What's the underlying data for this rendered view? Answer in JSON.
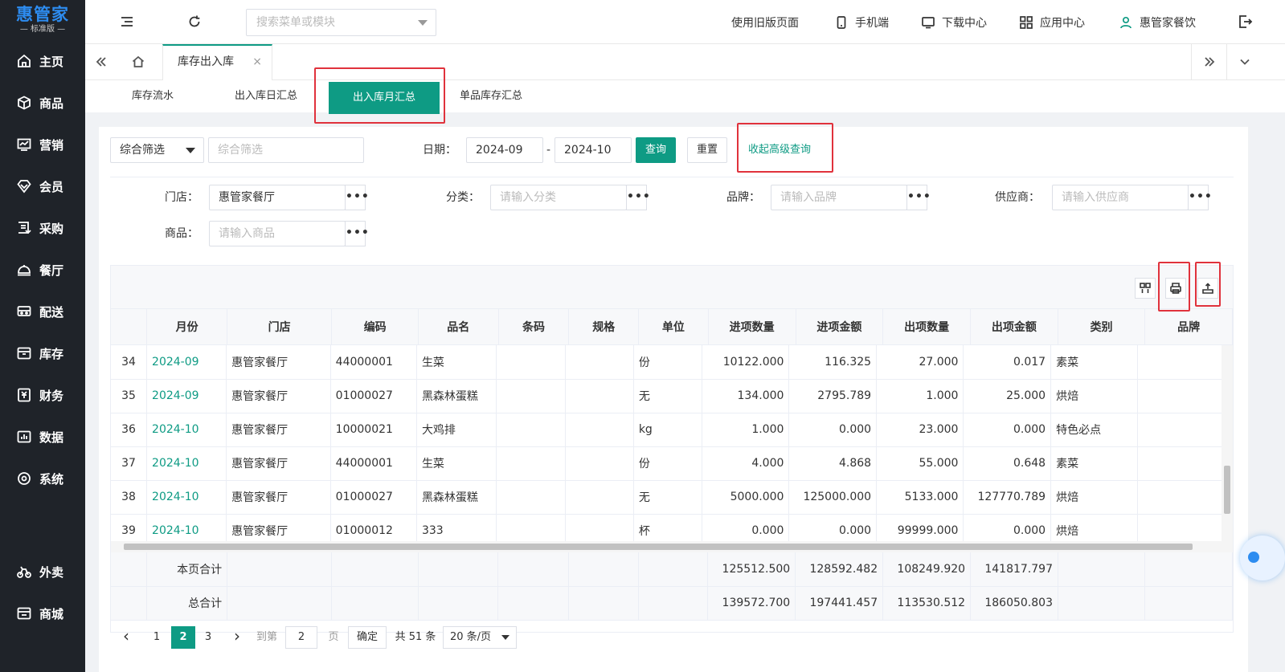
{
  "brand": {
    "name": "惠管家",
    "edition": "— 标准版 —"
  },
  "sidebar": {
    "items": [
      {
        "label": "主页",
        "icon": "home-icon"
      },
      {
        "label": "商品",
        "icon": "box-icon"
      },
      {
        "label": "营销",
        "icon": "chart-icon"
      },
      {
        "label": "会员",
        "icon": "diamond-icon"
      },
      {
        "label": "采购",
        "icon": "purchase-icon"
      },
      {
        "label": "餐厅",
        "icon": "cloche-icon"
      },
      {
        "label": "配送",
        "icon": "truck-icon"
      },
      {
        "label": "库存",
        "icon": "warehouse-icon"
      },
      {
        "label": "财务",
        "icon": "finance-icon"
      },
      {
        "label": "数据",
        "icon": "data-icon"
      },
      {
        "label": "系统",
        "icon": "gear-icon"
      },
      {
        "label": "外卖",
        "icon": "bike-icon"
      },
      {
        "label": "商城",
        "icon": "shop-icon"
      }
    ]
  },
  "topbar": {
    "search_placeholder": "搜索菜单或模块",
    "old_version": "使用旧版页面",
    "mobile": "手机端",
    "download": "下载中心",
    "apps": "应用中心",
    "user": "惠管家餐饮"
  },
  "tabs": {
    "active": "库存出入库",
    "close": "×"
  },
  "subnav": [
    "库存流水",
    "出入库日汇总",
    "出入库月汇总",
    "单品库存汇总"
  ],
  "filters": {
    "combo_select": "综合筛选",
    "combo_placeholder": "综合筛选",
    "date_label": "日期：",
    "date_start": "2024-09",
    "date_sep": "-",
    "date_end": "2024-10",
    "query": "查询",
    "reset": "重置",
    "collapse": "收起高级查询",
    "store_label": "门店：",
    "store_value": "惠管家餐厅",
    "category_label": "分类：",
    "category_placeholder": "请输入分类",
    "brand_label": "品牌：",
    "brand_placeholder": "请输入品牌",
    "supplier_label": "供应商：",
    "supplier_placeholder": "请输入供应商",
    "product_label": "商品：",
    "product_placeholder": "请输入商品",
    "dots": "•••"
  },
  "table": {
    "columns": [
      "月份",
      "门店",
      "编码",
      "品名",
      "条码",
      "规格",
      "单位",
      "进项数量",
      "进项金额",
      "出项数量",
      "出项金额",
      "类别",
      "品牌"
    ],
    "rows": [
      [
        "34",
        "2024-09",
        "惠管家餐厅",
        "44000001",
        "生菜",
        "",
        "",
        "份",
        "10122.000",
        "116.325",
        "27.000",
        "0.017",
        "素菜",
        ""
      ],
      [
        "35",
        "2024-09",
        "惠管家餐厅",
        "01000027",
        "黑森林蛋糕",
        "",
        "",
        "无",
        "134.000",
        "2795.789",
        "1.000",
        "25.000",
        "烘焙",
        ""
      ],
      [
        "36",
        "2024-10",
        "惠管家餐厅",
        "10000021",
        "大鸡排",
        "",
        "",
        "kg",
        "1.000",
        "0.000",
        "23.000",
        "0.000",
        "特色必点",
        ""
      ],
      [
        "37",
        "2024-10",
        "惠管家餐厅",
        "44000001",
        "生菜",
        "",
        "",
        "份",
        "4.000",
        "4.868",
        "55.000",
        "0.648",
        "素菜",
        ""
      ],
      [
        "38",
        "2024-10",
        "惠管家餐厅",
        "01000027",
        "黑森林蛋糕",
        "",
        "",
        "无",
        "5000.000",
        "125000.000",
        "5133.000",
        "127770.789",
        "烘焙",
        ""
      ],
      [
        "39",
        "2024-10",
        "惠管家餐厅",
        "01000012",
        "333",
        "",
        "",
        "杯",
        "0.000",
        "0.000",
        "99999.000",
        "0.000",
        "烘焙",
        ""
      ]
    ],
    "page_total": {
      "label": "本页合计",
      "in_qty": "125512.500",
      "in_amt": "128592.482",
      "out_qty": "108249.920",
      "out_amt": "141817.797"
    },
    "grand_total": {
      "label": "总合计",
      "in_qty": "139572.700",
      "in_amt": "197441.457",
      "out_qty": "113530.512",
      "out_amt": "186050.803"
    }
  },
  "pager": {
    "prev": "‹",
    "next": "›",
    "pages": [
      "1",
      "2",
      "3"
    ],
    "current": "2",
    "goto_label": "到第",
    "goto_value": "2",
    "page_unit": "页",
    "confirm": "确定",
    "total": "共 51 条",
    "page_size": "20 条/页"
  },
  "colors": {
    "accent": "#0e9b84",
    "sidebar": "#1f2329",
    "highlight": "#e0323c"
  }
}
